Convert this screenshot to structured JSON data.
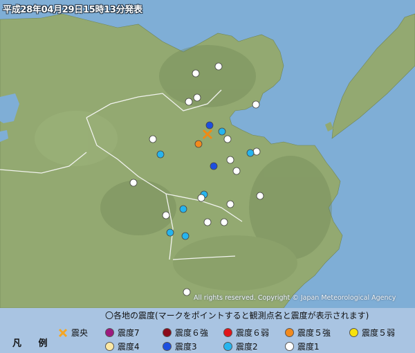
{
  "header": {
    "issued": "平成28年04月29日15時13分発表"
  },
  "copyright": "All rights reserved. Copyright © Japan Meteorological Agency",
  "legend": {
    "title": "〇各地の震度(マークをポイントすると観測点名と震度が表示されます)",
    "heading": "凡 例",
    "items": [
      {
        "label": "震央",
        "symbol": "epicenter-x",
        "color": "#f5a623"
      },
      {
        "label": "震度7",
        "symbol": "dot",
        "color": "#9c1a7e"
      },
      {
        "label": "震度６強",
        "symbol": "dot",
        "color": "#8b0a1a"
      },
      {
        "label": "震度６弱",
        "symbol": "dot",
        "color": "#e0151b"
      },
      {
        "label": "震度５強",
        "symbol": "dot",
        "color": "#f28a1d"
      },
      {
        "label": "震度５弱",
        "symbol": "dot",
        "color": "#f7e20c"
      },
      {
        "label": "震度4",
        "symbol": "dot",
        "color": "#fbe8a4"
      },
      {
        "label": "震度3",
        "symbol": "dot",
        "color": "#1c4fe0"
      },
      {
        "label": "震度2",
        "symbol": "dot",
        "color": "#26b4ee"
      },
      {
        "label": "震度1",
        "symbol": "dot",
        "color": "#ffffff"
      }
    ]
  },
  "colors": {
    "sea": "#7faed6",
    "land": "#94aa72",
    "intensity_5_weak": "#f28a1d",
    "intensity_3": "#1c4fe0",
    "intensity_2": "#26b4ee",
    "intensity_1": "#ffffff"
  },
  "observations": [
    {
      "intensity": "震度５弱相当(オレンジ)",
      "level": "5-"
    },
    {
      "intensity": "震度3",
      "level": "3"
    },
    {
      "intensity": "震度2",
      "level": "2"
    },
    {
      "intensity": "震度1",
      "level": "1"
    }
  ]
}
